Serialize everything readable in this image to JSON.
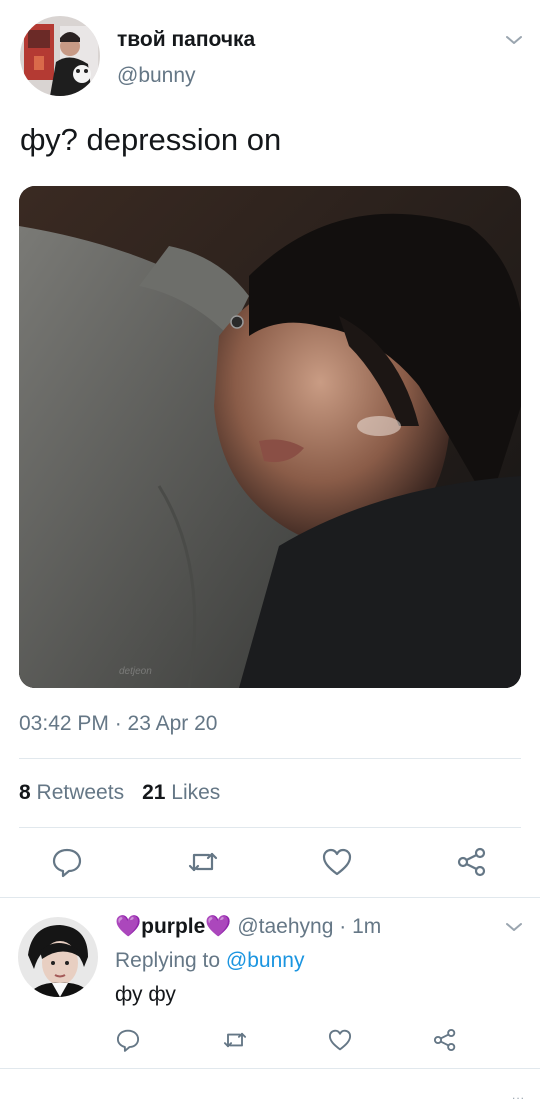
{
  "tweet": {
    "display_name": "твой папочка",
    "handle": "@bunny",
    "text": "фу? depression on",
    "watermark": "detjeon",
    "timestamp": "03:42 PM · 23 Apr 20",
    "retweets_count": "8",
    "retweets_label": "Retweets",
    "likes_count": "21",
    "likes_label": "Likes"
  },
  "reply": {
    "name": "purple",
    "heart_left": "💜",
    "heart_right": "💜",
    "handle": "@taehyng",
    "separator": " · ",
    "time": "1m",
    "replying_prefix": "Replying to ",
    "replying_to": "@bunny",
    "text": "фу фу"
  },
  "footer": {
    "more": "..."
  },
  "icons": [
    "chevron-down-icon",
    "reply-icon",
    "retweet-icon",
    "like-icon",
    "share-icon"
  ],
  "colors": {
    "text": "#14171a",
    "muted": "#657786",
    "link": "#1b95e0",
    "divider": "#e1e8ed",
    "purple_heart": "#7b3fd1"
  }
}
